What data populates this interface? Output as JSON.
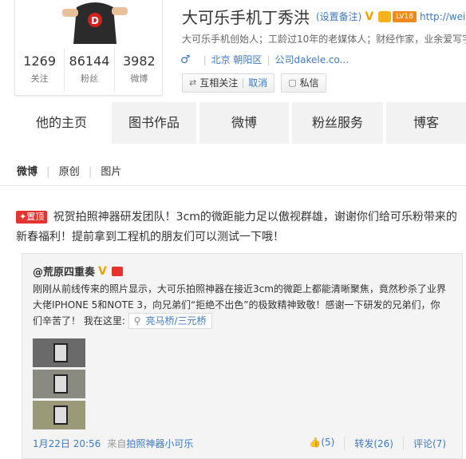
{
  "profile": {
    "name": "大可乐手机丁秀洪",
    "remark_link": "(设置备注)",
    "v_badge": "V",
    "level_badge": "LV18",
    "url": "http://weibo.",
    "bio": "大可乐手机创始人；工龄过10年的老媒体人；财经作家，业余爱写字",
    "gender_symbol": "♂",
    "location": "北京 朝阳区",
    "company": "公司dakele.co...",
    "stats": [
      {
        "value": "1269",
        "label": "关注"
      },
      {
        "value": "86144",
        "label": "粉丝"
      },
      {
        "value": "3982",
        "label": "微博"
      }
    ],
    "buttons": {
      "mutual_follow": "互相关注",
      "cancel": "取消",
      "message": "私信"
    }
  },
  "tabs": [
    {
      "label": "他的主页",
      "active": true
    },
    {
      "label": "图书作品",
      "active": false
    },
    {
      "label": "微博",
      "active": false
    },
    {
      "label": "粉丝服务",
      "active": false
    },
    {
      "label": "博客",
      "active": false
    }
  ],
  "subnav": [
    "微博",
    "原创",
    "图片"
  ],
  "post": {
    "pin_label": "置顶",
    "text": "祝贺拍照神器研发团队！3cm的微距能力足以傲视群雄，谢谢你们给可乐粉带来的新春福利！提前拿到工程机的朋友们可以测试一下哦！"
  },
  "repost": {
    "author": "@荒原四重奏",
    "text": "刚刚从前线传来的照片显示，大可乐拍照神器在接近3cm的微距上都能清晰聚焦，竟然秒杀了业界大佬IPHONE 5和NOTE 3，向兄弟们“拒绝不出色”的极致精神致敬！感谢一下研发的兄弟们，你们辛苦了！ 我在这里:",
    "location": "亮马桥/三元桥",
    "date": "1月22日 20:56",
    "from": "来自",
    "source": "拍照神器小可乐",
    "like": "(5)",
    "repost": "转发(26)",
    "comment": "评论(7)"
  },
  "colors": {
    "accent": "#3e7ac6",
    "pin": "#e8322e",
    "tab_bg": "#f2f2f2"
  }
}
